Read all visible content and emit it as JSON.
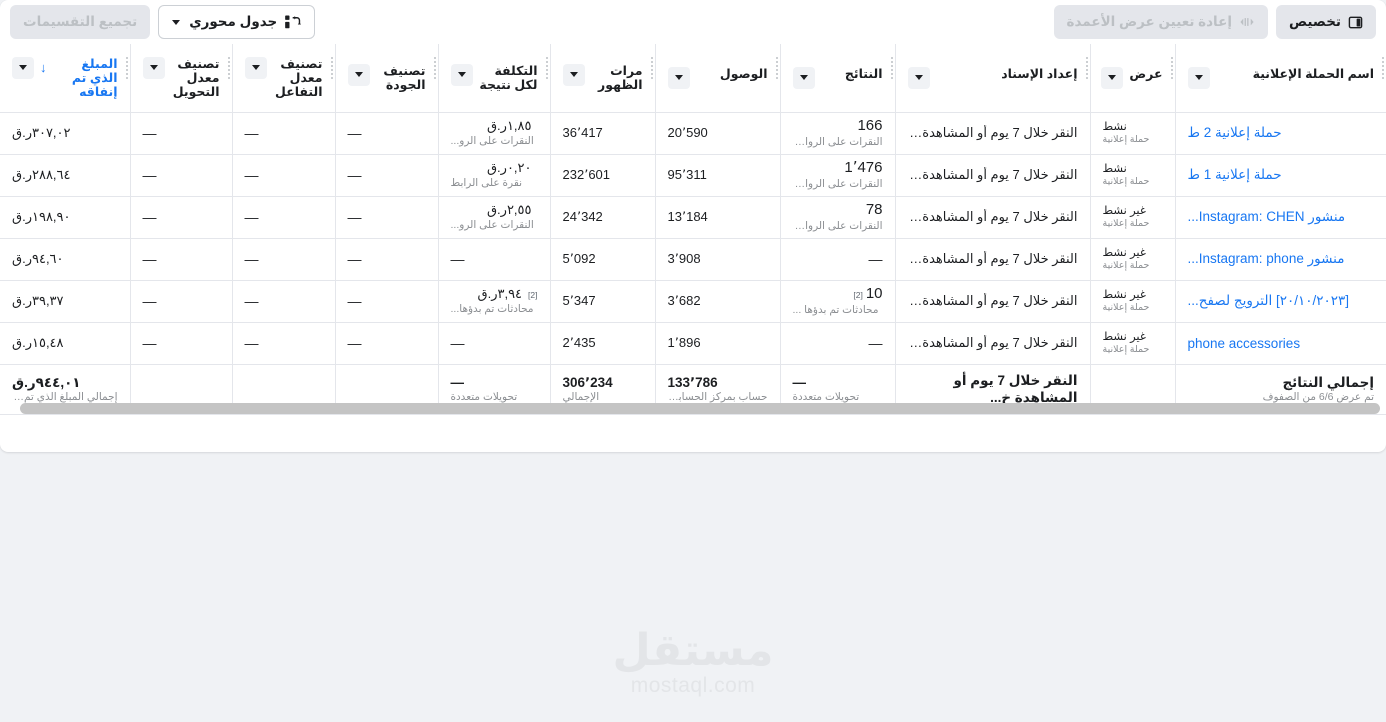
{
  "toolbar": {
    "customize_label": "تخصيص",
    "customize_icon": "columns-icon",
    "reset_columns_label": "إعادة تعيين عرض الأعمدة",
    "reset_columns_icon": "reset-width-icon",
    "group_breakdowns_label": "تجميع التقسيمات",
    "pivot_table_label": "جدول محوري",
    "pivot_table_icon": "pivot-table-icon",
    "caret_icon": "chevron-down-icon"
  },
  "columns": [
    {
      "label": "اسم الحملة الإعلانية",
      "key": "campaign",
      "menu": true,
      "sorted": false,
      "link": false
    },
    {
      "label": "عرض",
      "key": "delivery",
      "menu": true,
      "sorted": false,
      "link": false
    },
    {
      "label": "إعداد الإسناد",
      "key": "attribution",
      "menu": true,
      "sorted": false,
      "link": false
    },
    {
      "label": "النتائج",
      "key": "results",
      "menu": true,
      "sorted": false,
      "link": false
    },
    {
      "label": "الوصول",
      "key": "reach",
      "menu": true,
      "sorted": false,
      "link": false
    },
    {
      "label": "مرات الظهور",
      "key": "impressions",
      "menu": true,
      "sorted": false,
      "link": false
    },
    {
      "label": "التكلفة لكل نتيجة",
      "key": "cost_per_result",
      "menu": true,
      "sorted": false,
      "link": false
    },
    {
      "label": "تصنيف الجودة",
      "key": "quality_ranking",
      "menu": true,
      "sorted": false,
      "link": false
    },
    {
      "label": "تصنيف معدل التفاعل",
      "key": "engagement_ranking",
      "menu": true,
      "sorted": false,
      "link": false
    },
    {
      "label": "تصنيف معدل التحويل",
      "key": "conversion_ranking",
      "menu": true,
      "sorted": false,
      "link": false
    },
    {
      "label": "المبلغ الذي تم إنفاقه",
      "key": "amount_spent",
      "menu": true,
      "sorted": true,
      "link": true
    }
  ],
  "sort_arrow": "↓",
  "rows": [
    {
      "campaign": "حملة إعلانية 2 ط",
      "delivery_status": "نشط",
      "delivery_sub": "حملة إعلانية",
      "attribution": "النقر خلال 7 يوم أو المشاهدة خ...",
      "results_value": "166",
      "results_sup": "",
      "results_sub": "النقرات على الروابط",
      "reach": "20٬590",
      "impressions": "36٬417",
      "cost_value": "١,٨٥ر.ق",
      "cost_sup": "",
      "cost_sub": "النقرات على الرو...",
      "quality_ranking": "—",
      "engagement_ranking": "—",
      "conversion_ranking": "—",
      "amount_spent": "٣٠٧,٠٢ر.ق"
    },
    {
      "campaign": "حملة إعلانية 1 ط",
      "delivery_status": "نشط",
      "delivery_sub": "حملة إعلانية",
      "attribution": "النقر خلال 7 يوم أو المشاهدة خ...",
      "results_value": "1٬476",
      "results_sup": "",
      "results_sub": "النقرات على الروابط",
      "reach": "95٬311",
      "impressions": "232٬601",
      "cost_value": "٠,٢٠ر.ق",
      "cost_sup": "",
      "cost_sub": "نقرة على الرابط",
      "quality_ranking": "—",
      "engagement_ranking": "—",
      "conversion_ranking": "—",
      "amount_spent": "٢٨٨,٦٤ر.ق"
    },
    {
      "campaign": "منشور Instagram: CHEN...",
      "delivery_status": "غير نشط",
      "delivery_sub": "حملة إعلانية",
      "attribution": "النقر خلال 7 يوم أو المشاهدة خ...",
      "results_value": "78",
      "results_sup": "",
      "results_sub": "النقرات على الروابط",
      "reach": "13٬184",
      "impressions": "24٬342",
      "cost_value": "٢,٥٥ر.ق",
      "cost_sup": "",
      "cost_sub": "النقرات على الرو...",
      "quality_ranking": "—",
      "engagement_ranking": "—",
      "conversion_ranking": "—",
      "amount_spent": "١٩٨,٩٠ر.ق"
    },
    {
      "campaign": "منشور Instagram: phone...",
      "delivery_status": "غير نشط",
      "delivery_sub": "حملة إعلانية",
      "attribution": "النقر خلال 7 يوم أو المشاهدة خ...",
      "results_value": "—",
      "results_sup": "",
      "results_sub": "",
      "reach": "3٬908",
      "impressions": "5٬092",
      "cost_value": "—",
      "cost_sup": "",
      "cost_sub": "",
      "quality_ranking": "—",
      "engagement_ranking": "—",
      "conversion_ranking": "—",
      "amount_spent": "٩٤,٦٠ر.ق"
    },
    {
      "campaign": "[٢٠/١٠/٢٠٢٣] الترويج لصفح...",
      "delivery_status": "غير نشط",
      "delivery_sub": "حملة إعلانية",
      "attribution": "النقر خلال 7 يوم أو المشاهدة خ...",
      "results_value": "10",
      "results_sup": "[2]",
      "results_sub": "محادثات تم بدؤها ...",
      "reach": "3٬682",
      "impressions": "5٬347",
      "cost_value": "٣,٩٤ر.ق",
      "cost_sup": "[2]",
      "cost_sub": "محادثات تم بدؤها...",
      "quality_ranking": "—",
      "engagement_ranking": "—",
      "conversion_ranking": "—",
      "amount_spent": "٣٩,٣٧ر.ق"
    },
    {
      "campaign": "phone accessories",
      "delivery_status": "غير نشط",
      "delivery_sub": "حملة إعلانية",
      "attribution": "النقر خلال 7 يوم أو المشاهدة خ...",
      "results_value": "—",
      "results_sup": "",
      "results_sub": "",
      "reach": "1٬896",
      "impressions": "2٬435",
      "cost_value": "—",
      "cost_sup": "",
      "cost_sub": "",
      "quality_ranking": "—",
      "engagement_ranking": "—",
      "conversion_ranking": "—",
      "amount_spent": "١٥,٤٨ر.ق"
    }
  ],
  "totals": {
    "label": "إجمالي النتائج",
    "sub": "تم عرض 6/6 من الصفوف",
    "delivery": "",
    "attribution": "النقر خلال 7 يوم أو المشاهدة خ...",
    "results_value": "—",
    "results_sub": "تحويلات متعددة",
    "reach_value": "133٬786",
    "reach_sub": "حساب بمركز الحسابات",
    "impressions_value": "306٬234",
    "impressions_sub": "الإجمالي",
    "cost_value": "—",
    "cost_sub": "تحويلات متعددة",
    "quality_ranking": "",
    "engagement_ranking": "",
    "conversion_ranking": "",
    "amount_value": "٩٤٤,٠١ر.ق",
    "amount_sub": "إجمالي المبلغ الذي تم إنفاقه"
  },
  "watermark": {
    "arabic": "مستقل",
    "latin": "mostaql.com"
  }
}
